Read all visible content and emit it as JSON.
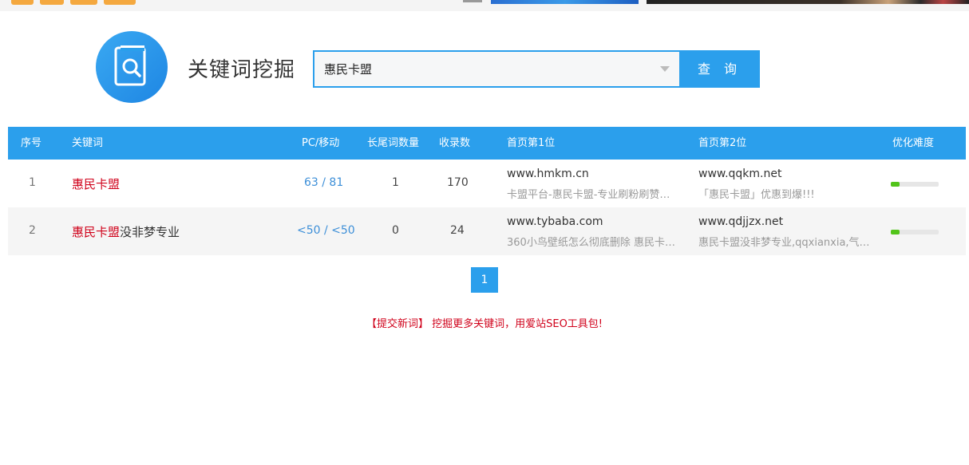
{
  "colors": {
    "accent": "#2b9fec",
    "highlight": "#d0021b",
    "difficulty": "#52c41a"
  },
  "header": {
    "title": "关键词挖掘"
  },
  "search": {
    "value": "惠民卡盟",
    "button": "查 询"
  },
  "table": {
    "columns": [
      "序号",
      "关键词",
      "PC/移动",
      "长尾词数量",
      "收录数",
      "首页第1位",
      "首页第2位",
      "优化难度"
    ],
    "rows": [
      {
        "index": "1",
        "keyword_highlight": "惠民卡盟",
        "keyword_rest": "",
        "pc_mobile": "63 / 81",
        "longtail": "1",
        "indexed": "170",
        "rank1_site": "www.hmkm.cn",
        "rank1_desc": "卡盟平台-惠民卡盟-专业刷粉刷赞…",
        "rank2_site": "www.qqkm.net",
        "rank2_desc": "「惠民卡盟」优惠到爆!!!",
        "difficulty": 0.18
      },
      {
        "index": "2",
        "keyword_highlight": "惠民卡盟",
        "keyword_rest": "没非梦专业",
        "pc_mobile": "<50 / <50",
        "longtail": "0",
        "indexed": "24",
        "rank1_site": "www.tybaba.com",
        "rank1_desc": "360小鸟壁纸怎么彻底删除 惠民卡…",
        "rank2_site": "www.qdjjzx.net",
        "rank2_desc": "惠民卡盟没非梦专业,qqxianxia,气…",
        "difficulty": 0.18
      }
    ]
  },
  "pagination": {
    "current": "1"
  },
  "footer": {
    "note": "【提交新词】 挖掘更多关键词，用爱站SEO工具包!"
  }
}
